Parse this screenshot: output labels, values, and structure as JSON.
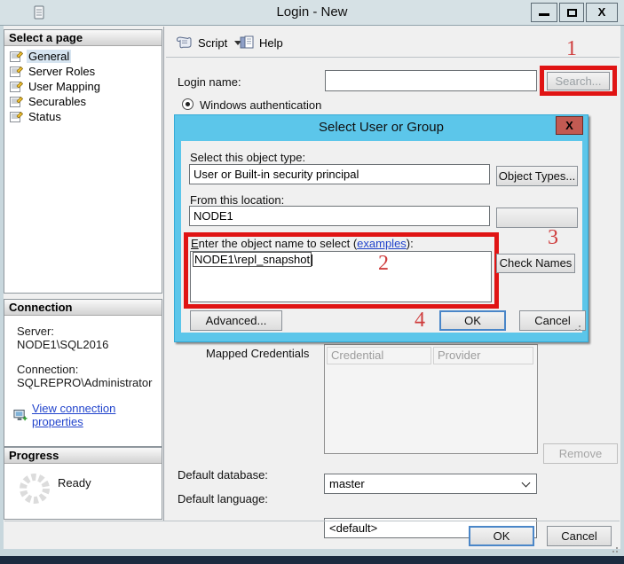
{
  "window": {
    "title": "Login - New"
  },
  "icons": {
    "close_glyph": "X"
  },
  "toolbar": {
    "script_label": "Script",
    "help_label": "Help"
  },
  "sidebar": {
    "pages_header": "Select a page",
    "pages": [
      "General",
      "Server Roles",
      "User Mapping",
      "Securables",
      "Status"
    ],
    "connection_header": "Connection",
    "server_label": "Server:",
    "server_value": "NODE1\\SQL2016",
    "connection_label": "Connection:",
    "connection_value": "SQLREPRO\\Administrator",
    "view_connection_properties": "View connection properties",
    "progress_header": "Progress",
    "progress_status": "Ready"
  },
  "main": {
    "login_name_label": "Login name:",
    "login_name_value": "",
    "search_button": "Search...",
    "windows_auth_label": "Windows authentication",
    "mapped_credentials_label": "Mapped Credentials",
    "credentials_table": {
      "columns": [
        "Credential",
        "Provider"
      ],
      "rows": []
    },
    "remove_button": "Remove",
    "default_database_label": "Default database:",
    "default_database_value": "master",
    "default_language_label": "Default language:",
    "default_language_value": "<default>",
    "ok_button": "OK",
    "cancel_button": "Cancel"
  },
  "dialog": {
    "title": "Select User or Group",
    "object_type_label": "Select this object type:",
    "object_type_value": "User or Built-in security principal",
    "object_types_button": "Object Types...",
    "location_label": "From this location:",
    "location_value": "NODE1",
    "object_name_label_e": "E",
    "object_name_label_rest": "nter the object name to select (",
    "object_name_link": "examples",
    "object_name_label_suffix": "):",
    "object_name_value": "NODE1\\repl_snapshot",
    "check_names_button": "Check Names",
    "advanced_button": "Advanced...",
    "ok_button": "OK",
    "cancel_button": "Cancel"
  },
  "annotations": {
    "step1": "1",
    "step2": "2",
    "step3": "3",
    "step4": "4",
    "highlight_color": "#e01414"
  }
}
